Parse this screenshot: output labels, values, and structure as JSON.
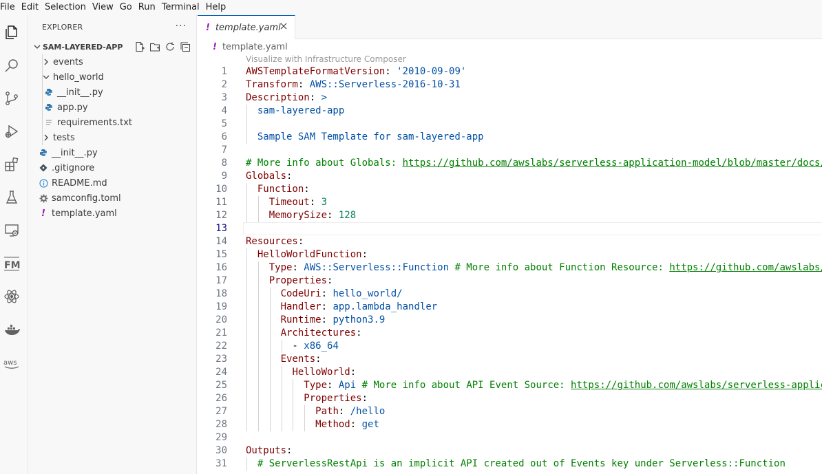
{
  "menu": [
    "File",
    "Edit",
    "Selection",
    "View",
    "Go",
    "Run",
    "Terminal",
    "Help"
  ],
  "explorer": {
    "title": "EXPLORER",
    "more": "···",
    "project": "SAM-LAYERED-APP",
    "tree": [
      {
        "label": "events",
        "type": "folder-collapsed",
        "depth": 1
      },
      {
        "label": "hello_world",
        "type": "folder-open",
        "depth": 1
      },
      {
        "label": "__init__.py",
        "type": "python",
        "depth": 2
      },
      {
        "label": "app.py",
        "type": "python",
        "depth": 2
      },
      {
        "label": "requirements.txt",
        "type": "text",
        "depth": 2
      },
      {
        "label": "tests",
        "type": "folder-collapsed",
        "depth": 1
      },
      {
        "label": "__init__.py",
        "type": "python",
        "depth": 1
      },
      {
        "label": ".gitignore",
        "type": "git",
        "depth": 1
      },
      {
        "label": "README.md",
        "type": "info",
        "depth": 1
      },
      {
        "label": "samconfig.toml",
        "type": "gear",
        "depth": 1
      },
      {
        "label": "template.yaml",
        "type": "yaml",
        "depth": 1
      }
    ]
  },
  "editor": {
    "tab_label": "template.yaml",
    "breadcrumb": "template.yaml",
    "codelens": "Visualize with Infrastructure Composer",
    "current_line": 13,
    "lines": [
      [
        [
          "k",
          "AWSTemplateFormatVersion"
        ],
        [
          "p",
          ": "
        ],
        [
          "s",
          "'2010-09-09'"
        ]
      ],
      [
        [
          "k",
          "Transform"
        ],
        [
          "p",
          ": "
        ],
        [
          "s",
          "AWS::Serverless-2016-10-31"
        ]
      ],
      [
        [
          "k",
          "Description"
        ],
        [
          "p",
          ": "
        ],
        [
          "s",
          ">"
        ]
      ],
      [
        [
          "p",
          "  "
        ],
        [
          "s",
          "sam-layered-app"
        ]
      ],
      [],
      [
        [
          "p",
          "  "
        ],
        [
          "s",
          "Sample SAM Template for sam-layered-app"
        ]
      ],
      [],
      [
        [
          "c",
          "# More info about Globals: "
        ],
        [
          "u",
          "https://github.com/awslabs/serverless-application-model/blob/master/docs/"
        ]
      ],
      [
        [
          "k",
          "Globals"
        ],
        [
          "p",
          ":"
        ]
      ],
      [
        [
          "p",
          "  "
        ],
        [
          "k",
          "Function"
        ],
        [
          "p",
          ":"
        ]
      ],
      [
        [
          "p",
          "    "
        ],
        [
          "k",
          "Timeout"
        ],
        [
          "p",
          ": "
        ],
        [
          "n",
          "3"
        ]
      ],
      [
        [
          "p",
          "    "
        ],
        [
          "k",
          "MemorySize"
        ],
        [
          "p",
          ": "
        ],
        [
          "n",
          "128"
        ]
      ],
      [],
      [
        [
          "k",
          "Resources"
        ],
        [
          "p",
          ":"
        ]
      ],
      [
        [
          "p",
          "  "
        ],
        [
          "k",
          "HelloWorldFunction"
        ],
        [
          "p",
          ":"
        ]
      ],
      [
        [
          "p",
          "    "
        ],
        [
          "k",
          "Type"
        ],
        [
          "p",
          ": "
        ],
        [
          "s",
          "AWS::Serverless::Function"
        ],
        [
          "c",
          " # More info about Function Resource: "
        ],
        [
          "u",
          "https://github.com/awslabs/"
        ]
      ],
      [
        [
          "p",
          "    "
        ],
        [
          "k",
          "Properties"
        ],
        [
          "p",
          ":"
        ]
      ],
      [
        [
          "p",
          "      "
        ],
        [
          "k",
          "CodeUri"
        ],
        [
          "p",
          ": "
        ],
        [
          "s",
          "hello_world/"
        ]
      ],
      [
        [
          "p",
          "      "
        ],
        [
          "k",
          "Handler"
        ],
        [
          "p",
          ": "
        ],
        [
          "s",
          "app.lambda_handler"
        ]
      ],
      [
        [
          "p",
          "      "
        ],
        [
          "k",
          "Runtime"
        ],
        [
          "p",
          ": "
        ],
        [
          "s",
          "python3.9"
        ]
      ],
      [
        [
          "p",
          "      "
        ],
        [
          "k",
          "Architectures"
        ],
        [
          "p",
          ":"
        ]
      ],
      [
        [
          "p",
          "        - "
        ],
        [
          "s",
          "x86_64"
        ]
      ],
      [
        [
          "p",
          "      "
        ],
        [
          "k",
          "Events"
        ],
        [
          "p",
          ":"
        ]
      ],
      [
        [
          "p",
          "        "
        ],
        [
          "k",
          "HelloWorld"
        ],
        [
          "p",
          ":"
        ]
      ],
      [
        [
          "p",
          "          "
        ],
        [
          "k",
          "Type"
        ],
        [
          "p",
          ": "
        ],
        [
          "s",
          "Api"
        ],
        [
          "c",
          " # More info about API Event Source: "
        ],
        [
          "u",
          "https://github.com/awslabs/serverless-applic"
        ]
      ],
      [
        [
          "p",
          "          "
        ],
        [
          "k",
          "Properties"
        ],
        [
          "p",
          ":"
        ]
      ],
      [
        [
          "p",
          "            "
        ],
        [
          "k",
          "Path"
        ],
        [
          "p",
          ": "
        ],
        [
          "s",
          "/hello"
        ]
      ],
      [
        [
          "p",
          "            "
        ],
        [
          "k",
          "Method"
        ],
        [
          "p",
          ": "
        ],
        [
          "s",
          "get"
        ]
      ],
      [],
      [
        [
          "k",
          "Outputs"
        ],
        [
          "p",
          ":"
        ]
      ],
      [
        [
          "p",
          "  "
        ],
        [
          "c",
          "# ServerlessRestApi is an implicit API created out of Events key under Serverless::Function"
        ]
      ]
    ]
  },
  "activity_icons": [
    "explorer-icon",
    "search-icon",
    "source-control-icon",
    "run-debug-icon",
    "extensions-icon",
    "testing-icon",
    "remote-explorer-icon",
    "fm-icon",
    "react-icon",
    "docker-icon",
    "aws-icon"
  ]
}
